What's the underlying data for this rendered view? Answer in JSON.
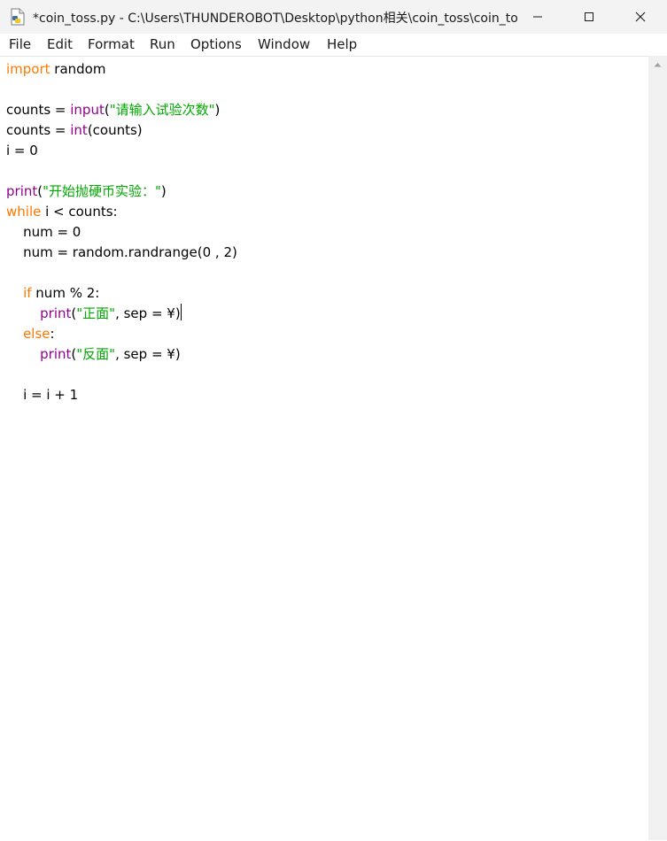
{
  "window": {
    "title": "*coin_toss.py - C:\\Users\\THUNDEROBOT\\Desktop\\python相关\\coin_toss\\coin_to..."
  },
  "menu": {
    "items": [
      "File",
      "Edit",
      "Format",
      "Run",
      "Options",
      "Window",
      "Help"
    ]
  },
  "code": {
    "lines": [
      [
        {
          "t": "kw",
          "v": "import"
        },
        {
          "t": "n",
          "v": " random"
        }
      ],
      [],
      [
        {
          "t": "n",
          "v": "counts = "
        },
        {
          "t": "bi",
          "v": "input"
        },
        {
          "t": "n",
          "v": "("
        },
        {
          "t": "st",
          "v": "\"请输入试验次数\""
        },
        {
          "t": "n",
          "v": ")"
        }
      ],
      [
        {
          "t": "n",
          "v": "counts = "
        },
        {
          "t": "bi",
          "v": "int"
        },
        {
          "t": "n",
          "v": "(counts)"
        }
      ],
      [
        {
          "t": "n",
          "v": "i = 0"
        }
      ],
      [],
      [
        {
          "t": "bi",
          "v": "print"
        },
        {
          "t": "n",
          "v": "("
        },
        {
          "t": "st",
          "v": "\"开始抛硬币实验：\""
        },
        {
          "t": "n",
          "v": ")"
        }
      ],
      [
        {
          "t": "kw",
          "v": "while"
        },
        {
          "t": "n",
          "v": " i < counts:"
        }
      ],
      [
        {
          "t": "n",
          "v": "    num = 0"
        }
      ],
      [
        {
          "t": "n",
          "v": "    num = random.randrange(0 , 2)"
        }
      ],
      [],
      [
        {
          "t": "n",
          "v": "    "
        },
        {
          "t": "kw",
          "v": "if"
        },
        {
          "t": "n",
          "v": " num % 2:"
        }
      ],
      [
        {
          "t": "n",
          "v": "        "
        },
        {
          "t": "bi",
          "v": "print"
        },
        {
          "t": "n",
          "v": "("
        },
        {
          "t": "st",
          "v": "\"正面\""
        },
        {
          "t": "n",
          "v": ", sep = ¥)"
        },
        {
          "t": "caret",
          "v": ""
        }
      ],
      [
        {
          "t": "n",
          "v": "    "
        },
        {
          "t": "kw",
          "v": "else"
        },
        {
          "t": "n",
          "v": ":"
        }
      ],
      [
        {
          "t": "n",
          "v": "        "
        },
        {
          "t": "bi",
          "v": "print"
        },
        {
          "t": "n",
          "v": "("
        },
        {
          "t": "st",
          "v": "\"反面\""
        },
        {
          "t": "n",
          "v": ", sep = ¥)"
        }
      ],
      [],
      [
        {
          "t": "n",
          "v": "    i = i + 1"
        }
      ]
    ]
  },
  "colors": {
    "keyword": "#ff7700",
    "builtin": "#900090",
    "string": "#00aa00"
  }
}
